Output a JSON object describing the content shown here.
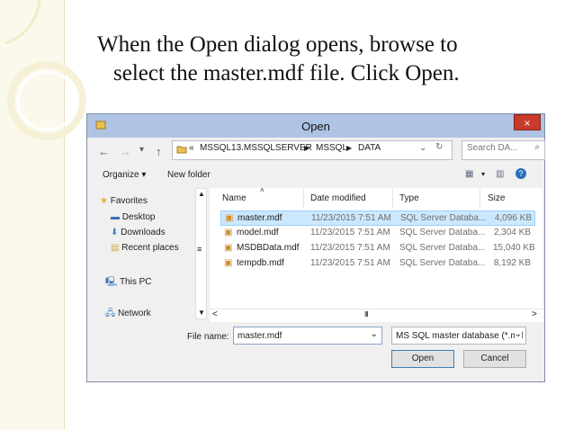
{
  "slide": {
    "caption_line1": "When the Open dialog opens, browse to",
    "caption_line2": "select the master.mdf file. Click Open."
  },
  "dialog": {
    "title": "Open",
    "address": {
      "breadcrumb_overflow": "«",
      "segments": [
        "MSSQL13.MSSQLSERVER",
        "MSSQL",
        "DATA"
      ],
      "separator": "▶"
    },
    "search_placeholder": "Search DA...",
    "toolbar": {
      "organize": "Organize ▾",
      "new_folder": "New folder"
    },
    "sidebar": {
      "favorites_label": "Favorites",
      "items": [
        {
          "label": "Desktop"
        },
        {
          "label": "Downloads"
        },
        {
          "label": "Recent places"
        }
      ],
      "this_pc": "This PC",
      "network": "Network"
    },
    "columns": {
      "name": "Name",
      "date_modified": "Date modified",
      "type": "Type",
      "size": "Size"
    },
    "files": [
      {
        "name": "master.mdf",
        "date": "11/23/2015 7:51 AM",
        "type": "SQL Server Databa...",
        "size": "4,096 KB",
        "selected": true
      },
      {
        "name": "model.mdf",
        "date": "11/23/2015 7:51 AM",
        "type": "SQL Server Databa...",
        "size": "2,304 KB",
        "selected": false
      },
      {
        "name": "MSDBData.mdf",
        "date": "11/23/2015 7:51 AM",
        "type": "SQL Server Databa...",
        "size": "15,040 KB",
        "selected": false
      },
      {
        "name": "tempdb.mdf",
        "date": "11/23/2015 7:51 AM",
        "type": "SQL Server Databa...",
        "size": "8,192 KB",
        "selected": false
      }
    ],
    "file_name_label": "File name:",
    "file_name_value": "master.mdf",
    "filter_value": "MS SQL master database (*.md",
    "open_label": "Open",
    "cancel_label": "Cancel",
    "scroll_grip": "III"
  },
  "colors": {
    "titlebar": "#afc4e3",
    "selected_row": "#cce8ff",
    "close_button": "#c83a2a",
    "folder_yellow": "#e8c154"
  }
}
